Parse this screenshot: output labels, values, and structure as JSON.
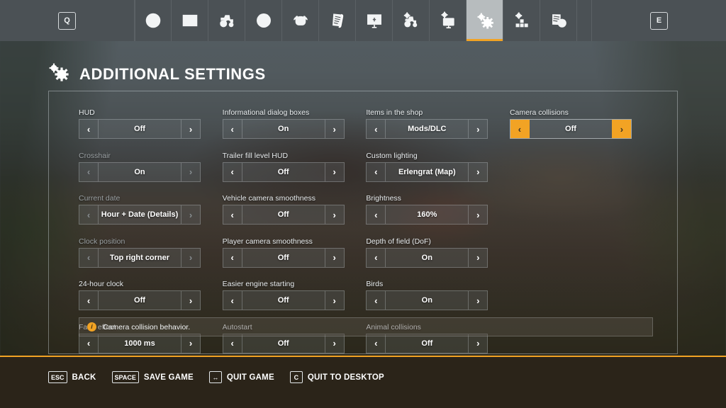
{
  "nav": {
    "left_key": "Q",
    "right_key": "E",
    "tabs": [
      {
        "icon": "globe-icon",
        "label": "Map",
        "active": false
      },
      {
        "icon": "statistics-icon",
        "label": "Statistics",
        "active": false
      },
      {
        "icon": "tractor-icon",
        "label": "Vehicles",
        "active": false
      },
      {
        "icon": "finances-icon",
        "label": "Finances",
        "active": false
      },
      {
        "icon": "animals-icon",
        "label": "Animals",
        "active": false
      },
      {
        "icon": "contracts-icon",
        "label": "Contracts",
        "active": false
      },
      {
        "icon": "presentation-icon",
        "label": "Production",
        "active": false
      },
      {
        "icon": "vehicle-settings-icon",
        "label": "Vehicle Settings",
        "active": false
      },
      {
        "icon": "display-settings-icon",
        "label": "Display Settings",
        "active": false
      },
      {
        "icon": "additional-settings-icon",
        "label": "Additional Settings",
        "active": true
      },
      {
        "icon": "mods-icon",
        "label": "Mods",
        "active": false
      },
      {
        "icon": "info-document-icon",
        "label": "Help",
        "active": false
      }
    ]
  },
  "page": {
    "title": "ADDITIONAL SETTINGS",
    "title_icon": "gears-icon"
  },
  "settings": {
    "columns": [
      {
        "options": [
          {
            "label": "HUD",
            "value": "Off",
            "state": "normal"
          },
          {
            "label": "Crosshair",
            "value": "On",
            "state": "disabled"
          },
          {
            "label": "Current date",
            "value": "Hour + Date (Details)",
            "state": "disabled"
          },
          {
            "label": "Clock position",
            "value": "Top right corner",
            "state": "disabled"
          },
          {
            "label": "24-hour clock",
            "value": "Off",
            "state": "normal"
          },
          {
            "label": "Fade effect",
            "value": "1000 ms",
            "state": "normal"
          }
        ]
      },
      {
        "options": [
          {
            "label": "Informational dialog boxes",
            "value": "On",
            "state": "normal"
          },
          {
            "label": "Trailer fill level HUD",
            "value": "Off",
            "state": "normal"
          },
          {
            "label": "Vehicle camera smoothness",
            "value": "Off",
            "state": "normal"
          },
          {
            "label": "Player camera smoothness",
            "value": "Off",
            "state": "normal"
          },
          {
            "label": "Easier engine starting",
            "value": "Off",
            "state": "normal"
          },
          {
            "label": "Autostart",
            "value": "Off",
            "state": "normal"
          }
        ]
      },
      {
        "options": [
          {
            "label": "Items in the shop",
            "value": "Mods/DLC",
            "state": "normal"
          },
          {
            "label": "Custom lighting",
            "value": "Erlengrat (Map)",
            "state": "normal"
          },
          {
            "label": "Brightness",
            "value": "160%",
            "state": "normal"
          },
          {
            "label": "Depth of field (DoF)",
            "value": "On",
            "state": "normal"
          },
          {
            "label": "Birds",
            "value": "On",
            "state": "normal"
          },
          {
            "label": "Animal collisions",
            "value": "Off",
            "state": "normal"
          }
        ]
      },
      {
        "options": [
          {
            "label": "Camera collisions",
            "value": "Off",
            "state": "selected"
          }
        ]
      }
    ],
    "arrow_left": "‹",
    "arrow_right": "›"
  },
  "info": {
    "icon": "info-icon",
    "icon_glyph": "i",
    "text": "Camera collision behavior."
  },
  "footer": {
    "hints": [
      {
        "key": "ESC",
        "label": "BACK"
      },
      {
        "key": "SPACE",
        "label": "SAVE GAME"
      },
      {
        "key": "↔",
        "label": "QUIT GAME"
      },
      {
        "key": "C",
        "label": "QUIT TO DESKTOP"
      }
    ]
  },
  "colors": {
    "accent": "#f2a324",
    "topbar": "#4b5155",
    "footer": "#2b2419",
    "tab_active": "#b7bcbe"
  }
}
